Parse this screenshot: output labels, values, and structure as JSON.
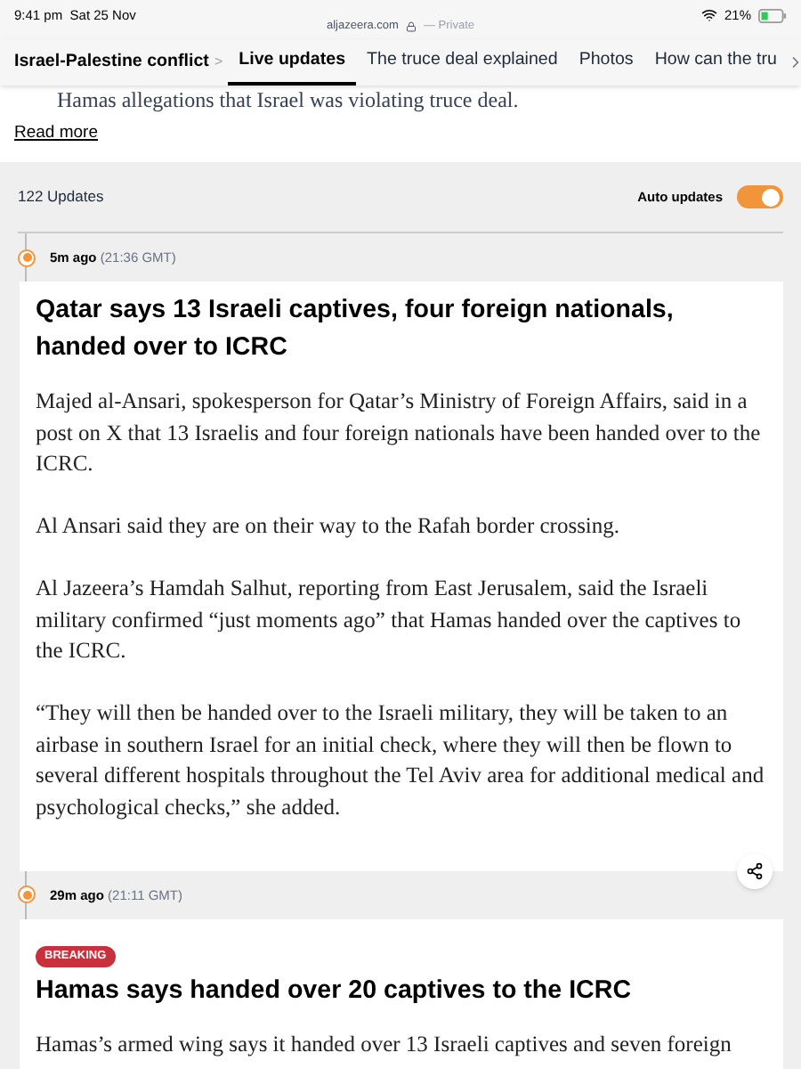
{
  "status_bar": {
    "time": "9:41 pm",
    "date": "Sat 25 Nov",
    "url": "aljazeera.com",
    "mode": "— Private",
    "battery": "21%"
  },
  "nav": {
    "section": "Israel-Palestine conflict",
    "separator": ">",
    "tabs": [
      {
        "label": "Live updates",
        "selected": true
      },
      {
        "label": "The truce deal explained",
        "selected": false
      },
      {
        "label": "Photos",
        "selected": false
      },
      {
        "label": "How can the tru",
        "selected": false
      }
    ]
  },
  "intro": {
    "text": "Hamas allegations that Israel was violating truce deal.",
    "link": "Read more"
  },
  "updates": {
    "count": "122 Updates",
    "auto_label": "Auto updates",
    "auto_on": true
  },
  "posts": [
    {
      "ago": "5m ago",
      "time": "(21:36 GMT)",
      "title": "Qatar says 13 Israeli captives, four foreign nationals, handed over to ICRC",
      "paragraphs": [
        "Majed al-Ansari, spokesperson for Qatar’s Ministry of Foreign Affairs, said in a post on X that 13 Israelis and four foreign nationals have been handed over to the ICRC.",
        "Al Ansari said they are on their way to the Rafah border crossing.",
        "Al Jazeera’s Hamdah Salhut, reporting from East Jerusalem, said the Israeli military confirmed “just moments ago” that Hamas handed over the captives to the ICRC.",
        "“They will then be handed over to the Israeli military, they will be taken to an airbase in southern Israel for an initial check, where they will then be flown to several different hospitals throughout the Tel Aviv area for additional medical and psychological checks,” she added."
      ],
      "share": true
    },
    {
      "ago": "29m ago",
      "time": "(21:11 GMT)",
      "breaking": "BREAKING",
      "title": "Hamas says handed over 20 captives to the ICRC",
      "paragraphs": [
        "Hamas’s armed wing says it handed over 13 Israeli captives and seven foreign"
      ],
      "share": false
    }
  ]
}
